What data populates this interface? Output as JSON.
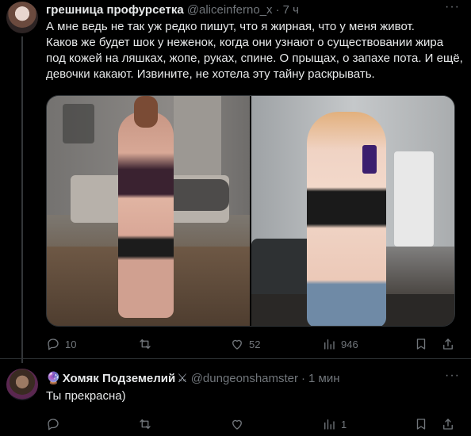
{
  "tweet1": {
    "name": "грешница профурсетка",
    "handle": "@aliceinferno_x",
    "time": "7 ч",
    "text_lines": [
      "А мне ведь не так уж редко пишут, что я жирная, что у меня живот.",
      "Каков же будет шок у неженок, когда они узнают о существовании жира",
      "под кожей на ляшках, жопе, руках, спине. О прыщах, о запахе пота. И ещё,",
      "девочки какают. Извините, не хотела эту тайну раскрывать."
    ],
    "counts": {
      "replies": "10",
      "retweets": "",
      "likes": "52",
      "views": "946"
    }
  },
  "tweet2": {
    "name_prefix": "🔮",
    "name": "Хомяк Подземелий",
    "name_suffix": "⚔",
    "handle": "@dungeonshamster",
    "time": "1 мин",
    "text": "Ты прекрасна)",
    "counts": {
      "replies": "",
      "retweets": "",
      "likes": "",
      "views": "1"
    }
  },
  "icons": {
    "reply": "reply-icon",
    "retweet": "retweet-icon",
    "like": "heart-icon",
    "views": "views-icon",
    "bookmark": "bookmark-icon",
    "share": "share-icon",
    "more": "more-icon"
  },
  "colors": {
    "background": "#000000",
    "text": "#e7e9ea",
    "muted": "#71767b",
    "divider": "#2f3336"
  }
}
